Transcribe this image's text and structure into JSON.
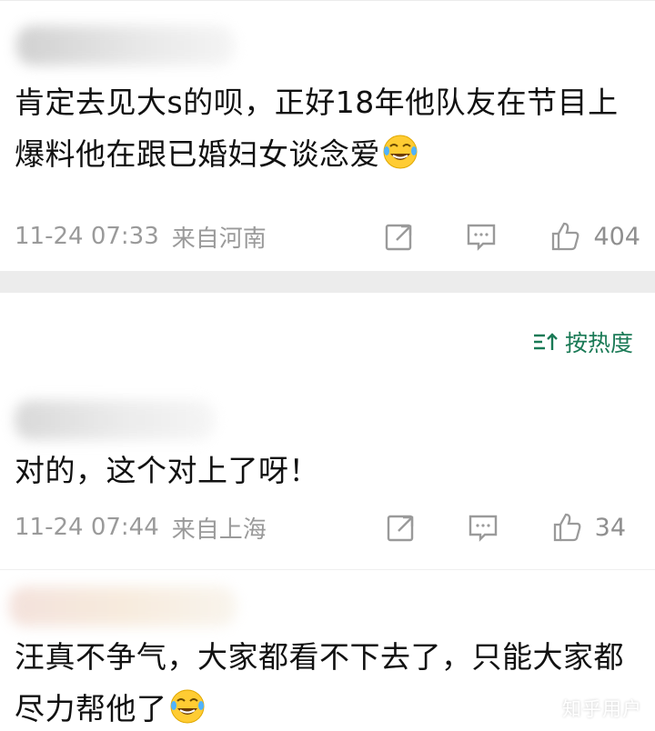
{
  "comments": [
    {
      "text": "肯定去见大s的呗，正好18年他队友在节目上爆料他在跟已婚妇女谈念爱",
      "time": "11-24 07:33",
      "location": "来自河南",
      "likes": "404",
      "emoji": "tears-of-joy-emoji"
    },
    {
      "text": "对的，这个对上了呀！",
      "time": "11-24 07:44",
      "location": "来自上海",
      "likes": "34"
    },
    {
      "text": "汪真不争气，大家都看不下去了，只能大家都尽力帮他了",
      "emoji": "crying-laughing-emoji"
    }
  ],
  "sort": {
    "label": "按热度",
    "icon": "sort-icon"
  },
  "watermark": "知乎用户",
  "colors": {
    "accent": "#1a7a56",
    "meta_text": "#9a9a9a",
    "section_gap": "#ececec"
  },
  "icons": {
    "share": "share-icon",
    "reply": "comment-icon",
    "like": "thumbs-up-icon"
  }
}
